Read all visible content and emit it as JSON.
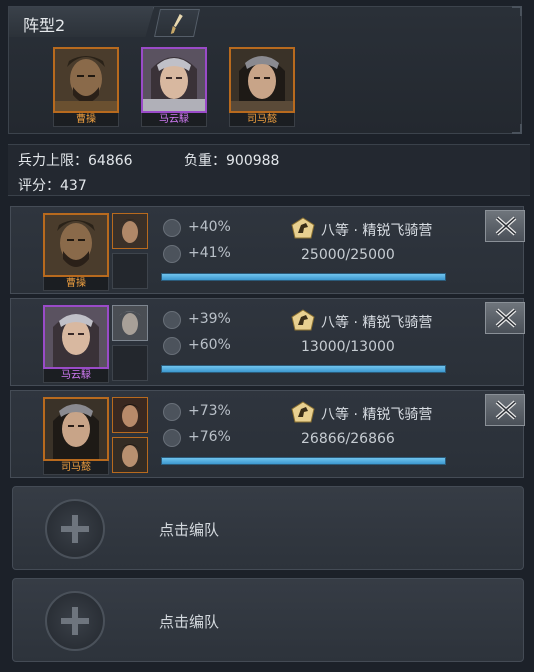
{
  "formation": {
    "title": "阵型2",
    "edit_icon": "brush-icon",
    "heroes": [
      {
        "name": "曹操",
        "rarity": "orange"
      },
      {
        "name": "马云騄",
        "rarity": "purple"
      },
      {
        "name": "司马懿",
        "rarity": "orange"
      }
    ]
  },
  "stats": {
    "troop_limit_label": "兵力上限：",
    "troop_limit_value": "64866",
    "load_label": "负重：",
    "load_value": "900988",
    "score_label": "评分：",
    "score_value": "437"
  },
  "troops": [
    {
      "hero": "曹操",
      "attack_bonus": "+40%",
      "defense_bonus": "+41%",
      "unit_name": "八等 · 精锐飞骑营",
      "count": "25000/25000",
      "fill": 1.0,
      "sub_slot": "filled",
      "second_slot": "empty"
    },
    {
      "hero": "马云騄",
      "attack_bonus": "+39%",
      "defense_bonus": "+60%",
      "unit_name": "八等 · 精锐飞骑营",
      "count": "13000/13000",
      "fill": 1.0,
      "sub_slot": "filled-grey",
      "second_slot": "empty"
    },
    {
      "hero": "司马懿",
      "attack_bonus": "+73%",
      "defense_bonus": "+76%",
      "unit_name": "八等 · 精锐飞骑营",
      "count": "26866/26866",
      "fill": 1.0,
      "sub_slot": "filled",
      "second_slot": "filled"
    }
  ],
  "empty_slots": [
    {
      "label": "点击编队"
    },
    {
      "label": "点击编队"
    }
  ],
  "colors": {
    "orange_frame": "#b86a1e",
    "purple_frame": "#9a4bc8",
    "bar_fill": "#4aa6da"
  }
}
